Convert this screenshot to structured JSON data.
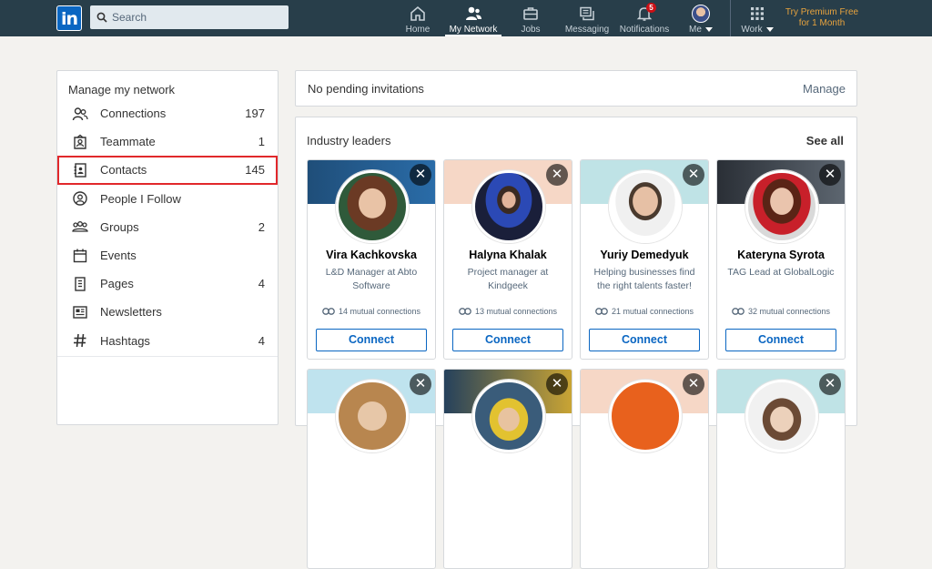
{
  "topbar": {
    "logo": "in",
    "search_placeholder": "Search",
    "nav": [
      {
        "label": "Home"
      },
      {
        "label": "My Network"
      },
      {
        "label": "Jobs"
      },
      {
        "label": "Messaging"
      },
      {
        "label": "Notifications",
        "badge": "5"
      },
      {
        "label": "Me"
      },
      {
        "label": "Work"
      }
    ],
    "premium_line1": "Try Premium Free",
    "premium_line2": "for 1 Month"
  },
  "sidebar": {
    "title": "Manage my network",
    "items": [
      {
        "label": "Connections",
        "count": "197"
      },
      {
        "label": "Teammate",
        "count": "1"
      },
      {
        "label": "Contacts",
        "count": "145"
      },
      {
        "label": "People I Follow",
        "count": ""
      },
      {
        "label": "Groups",
        "count": "2"
      },
      {
        "label": "Events",
        "count": ""
      },
      {
        "label": "Pages",
        "count": "4"
      },
      {
        "label": "Newsletters",
        "count": ""
      },
      {
        "label": "Hashtags",
        "count": "4"
      }
    ]
  },
  "invitations": {
    "text": "No pending invitations",
    "manage": "Manage"
  },
  "leaders": {
    "title": "Industry leaders",
    "see_all": "See all",
    "close_glyph": "✕",
    "connect_label": "Connect",
    "people": [
      {
        "name": "Vira Kachkovska",
        "title": "L&D Manager at Abto Software",
        "mutual": "14 mutual connections"
      },
      {
        "name": "Halyna Khalak",
        "title": "Project manager at Kindgeek",
        "mutual": "13 mutual connections"
      },
      {
        "name": "Yuriy Demedyuk",
        "title": "Helping businesses find the right talents faster!",
        "mutual": "21 mutual connections"
      },
      {
        "name": "Kateryna Syrota",
        "title": "TAG Lead at GlobalLogic",
        "mutual": "32 mutual connections"
      }
    ]
  },
  "colors": {
    "nav_bg": "#283e4a",
    "accent": "#0a66c2",
    "highlight": "#e1282b",
    "premium": "#e7a33e"
  }
}
